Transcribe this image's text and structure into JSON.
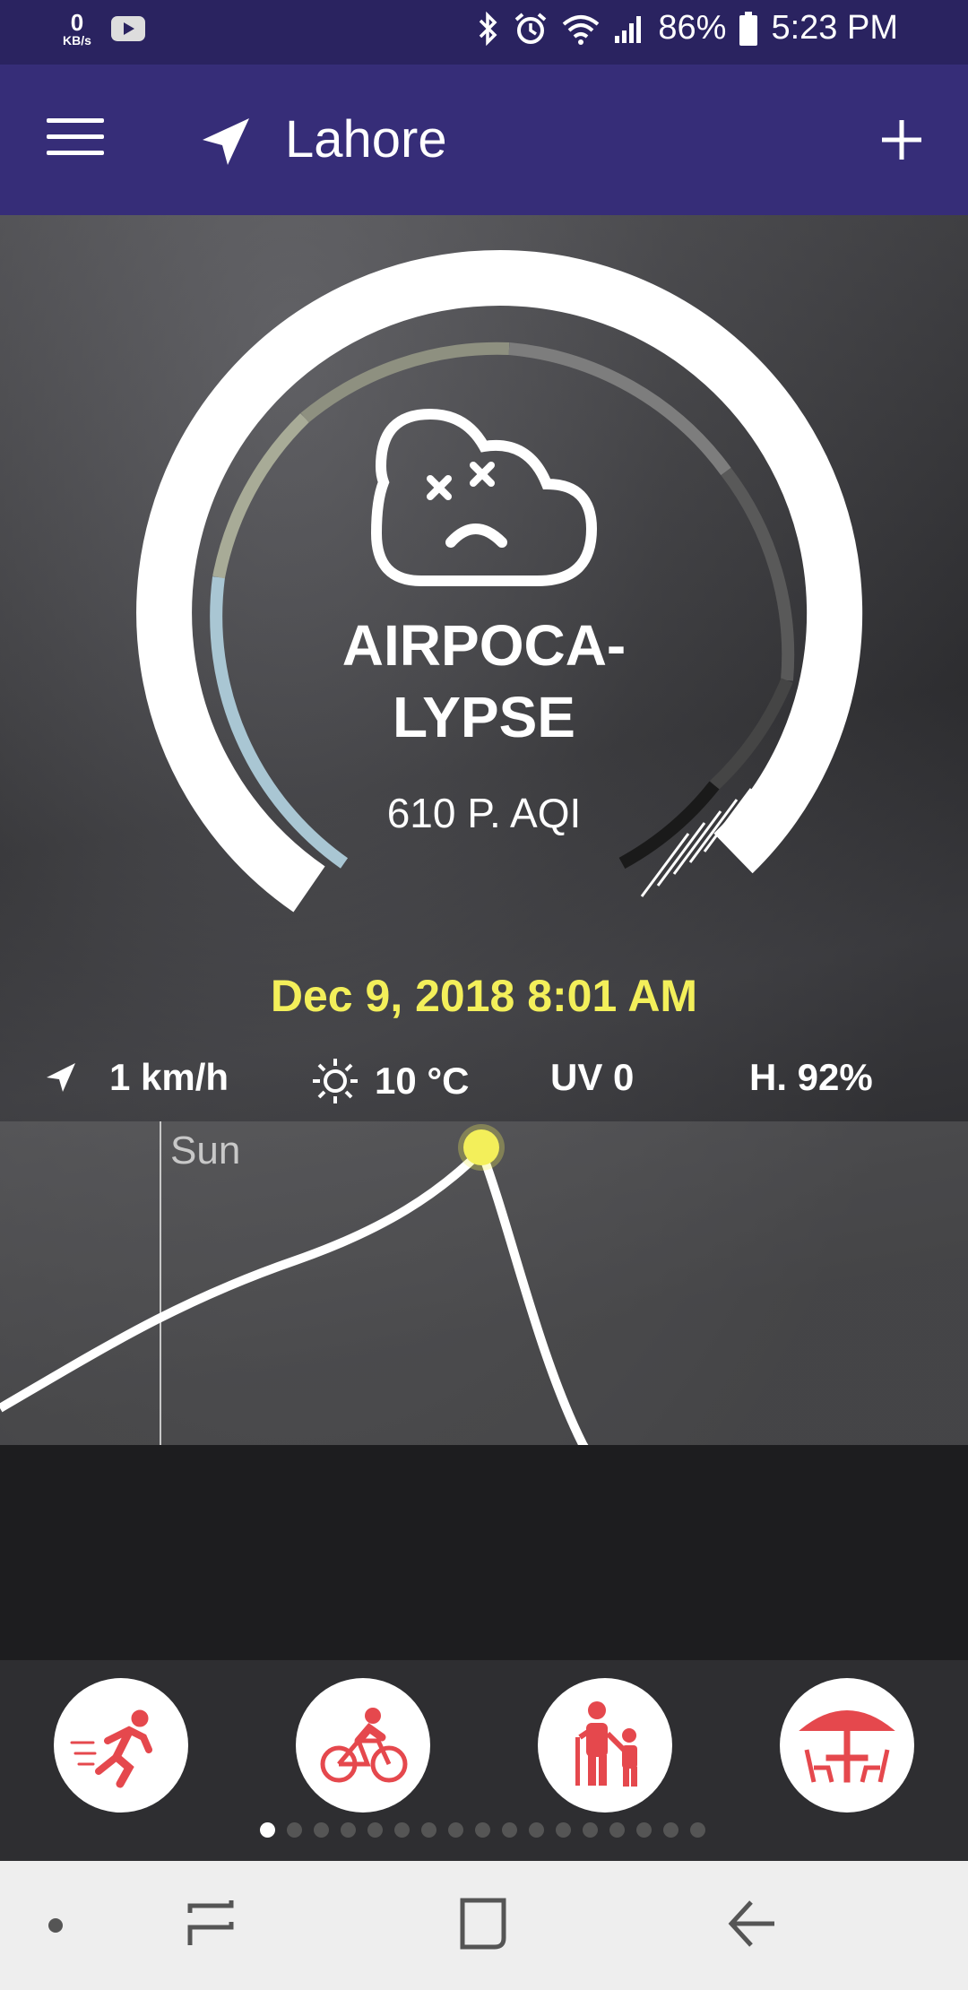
{
  "status_bar": {
    "net_speed": "0",
    "net_unit": "KB/s",
    "battery": "86%",
    "time": "5:23 PM"
  },
  "app_bar": {
    "city": "Lahore"
  },
  "air": {
    "status": "AIRPOCA-\nLYPSE",
    "status_line1": "AIRPOCA-",
    "status_line2": "LYPSE",
    "aqi": "610 P. AQI",
    "datetime": "Dec 9, 2018 8:01 AM",
    "gauge_level": 1.0
  },
  "metrics": {
    "wind": "1 km/h",
    "temp": "10 °C",
    "uv": "UV 0",
    "humidity": "H. 92%"
  },
  "chart": {
    "day_label": "Sun"
  },
  "activities": [
    "running",
    "cycling",
    "elderly-and-children",
    "outdoor-dining"
  ],
  "pager": {
    "total": 17,
    "active": 0
  },
  "colors": {
    "status_bar": "#2a2360",
    "app_bar": "#362d78",
    "accent_yellow": "#f3ef5a",
    "activity_red": "#e5484d"
  }
}
